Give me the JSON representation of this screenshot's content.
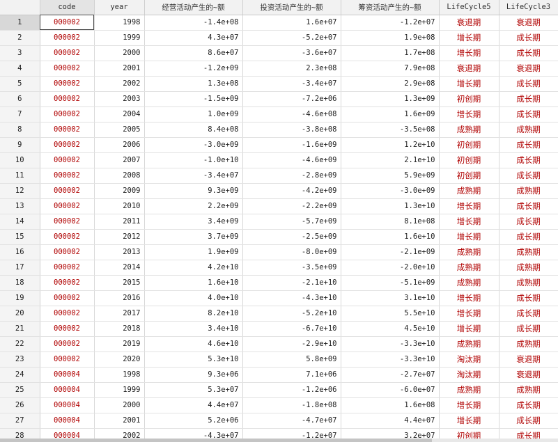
{
  "columns": [
    "code",
    "year",
    "经营活动产生的~额",
    "投资活动产生的~额",
    "筹资活动产生的~额",
    "LifeCycle5",
    "LifeCycle3"
  ],
  "selected_row": 1,
  "rows": [
    {
      "n": "1",
      "code": "000002",
      "year": "1998",
      "op": "-1.4e+08",
      "inv": "1.6e+07",
      "fin": "-1.2e+07",
      "lc5": "衰退期",
      "lc3": "衰退期"
    },
    {
      "n": "2",
      "code": "000002",
      "year": "1999",
      "op": "4.3e+07",
      "inv": "-5.2e+07",
      "fin": "1.9e+08",
      "lc5": "增长期",
      "lc3": "成长期"
    },
    {
      "n": "3",
      "code": "000002",
      "year": "2000",
      "op": "8.6e+07",
      "inv": "-3.6e+07",
      "fin": "1.7e+08",
      "lc5": "增长期",
      "lc3": "成长期"
    },
    {
      "n": "4",
      "code": "000002",
      "year": "2001",
      "op": "-1.2e+09",
      "inv": "2.3e+08",
      "fin": "7.9e+08",
      "lc5": "衰退期",
      "lc3": "衰退期"
    },
    {
      "n": "5",
      "code": "000002",
      "year": "2002",
      "op": "1.3e+08",
      "inv": "-3.4e+07",
      "fin": "2.9e+08",
      "lc5": "增长期",
      "lc3": "成长期"
    },
    {
      "n": "6",
      "code": "000002",
      "year": "2003",
      "op": "-1.5e+09",
      "inv": "-7.2e+06",
      "fin": "1.3e+09",
      "lc5": "初创期",
      "lc3": "成长期"
    },
    {
      "n": "7",
      "code": "000002",
      "year": "2004",
      "op": "1.0e+09",
      "inv": "-4.6e+08",
      "fin": "1.6e+09",
      "lc5": "增长期",
      "lc3": "成长期"
    },
    {
      "n": "8",
      "code": "000002",
      "year": "2005",
      "op": "8.4e+08",
      "inv": "-3.8e+08",
      "fin": "-3.5e+08",
      "lc5": "成熟期",
      "lc3": "成熟期"
    },
    {
      "n": "9",
      "code": "000002",
      "year": "2006",
      "op": "-3.0e+09",
      "inv": "-1.6e+09",
      "fin": "1.2e+10",
      "lc5": "初创期",
      "lc3": "成长期"
    },
    {
      "n": "10",
      "code": "000002",
      "year": "2007",
      "op": "-1.0e+10",
      "inv": "-4.6e+09",
      "fin": "2.1e+10",
      "lc5": "初创期",
      "lc3": "成长期"
    },
    {
      "n": "11",
      "code": "000002",
      "year": "2008",
      "op": "-3.4e+07",
      "inv": "-2.8e+09",
      "fin": "5.9e+09",
      "lc5": "初创期",
      "lc3": "成长期"
    },
    {
      "n": "12",
      "code": "000002",
      "year": "2009",
      "op": "9.3e+09",
      "inv": "-4.2e+09",
      "fin": "-3.0e+09",
      "lc5": "成熟期",
      "lc3": "成熟期"
    },
    {
      "n": "13",
      "code": "000002",
      "year": "2010",
      "op": "2.2e+09",
      "inv": "-2.2e+09",
      "fin": "1.3e+10",
      "lc5": "增长期",
      "lc3": "成长期"
    },
    {
      "n": "14",
      "code": "000002",
      "year": "2011",
      "op": "3.4e+09",
      "inv": "-5.7e+09",
      "fin": "8.1e+08",
      "lc5": "增长期",
      "lc3": "成长期"
    },
    {
      "n": "15",
      "code": "000002",
      "year": "2012",
      "op": "3.7e+09",
      "inv": "-2.5e+09",
      "fin": "1.6e+10",
      "lc5": "增长期",
      "lc3": "成长期"
    },
    {
      "n": "16",
      "code": "000002",
      "year": "2013",
      "op": "1.9e+09",
      "inv": "-8.0e+09",
      "fin": "-2.1e+09",
      "lc5": "成熟期",
      "lc3": "成熟期"
    },
    {
      "n": "17",
      "code": "000002",
      "year": "2014",
      "op": "4.2e+10",
      "inv": "-3.5e+09",
      "fin": "-2.0e+10",
      "lc5": "成熟期",
      "lc3": "成熟期"
    },
    {
      "n": "18",
      "code": "000002",
      "year": "2015",
      "op": "1.6e+10",
      "inv": "-2.1e+10",
      "fin": "-5.1e+09",
      "lc5": "成熟期",
      "lc3": "成熟期"
    },
    {
      "n": "19",
      "code": "000002",
      "year": "2016",
      "op": "4.0e+10",
      "inv": "-4.3e+10",
      "fin": "3.1e+10",
      "lc5": "增长期",
      "lc3": "成长期"
    },
    {
      "n": "20",
      "code": "000002",
      "year": "2017",
      "op": "8.2e+10",
      "inv": "-5.2e+10",
      "fin": "5.5e+10",
      "lc5": "增长期",
      "lc3": "成长期"
    },
    {
      "n": "21",
      "code": "000002",
      "year": "2018",
      "op": "3.4e+10",
      "inv": "-6.7e+10",
      "fin": "4.5e+10",
      "lc5": "增长期",
      "lc3": "成长期"
    },
    {
      "n": "22",
      "code": "000002",
      "year": "2019",
      "op": "4.6e+10",
      "inv": "-2.9e+10",
      "fin": "-3.3e+10",
      "lc5": "成熟期",
      "lc3": "成熟期"
    },
    {
      "n": "23",
      "code": "000002",
      "year": "2020",
      "op": "5.3e+10",
      "inv": "5.8e+09",
      "fin": "-3.3e+10",
      "lc5": "淘汰期",
      "lc3": "衰退期"
    },
    {
      "n": "24",
      "code": "000004",
      "year": "1998",
      "op": "9.3e+06",
      "inv": "7.1e+06",
      "fin": "-2.7e+07",
      "lc5": "淘汰期",
      "lc3": "衰退期"
    },
    {
      "n": "25",
      "code": "000004",
      "year": "1999",
      "op": "5.3e+07",
      "inv": "-1.2e+06",
      "fin": "-6.0e+07",
      "lc5": "成熟期",
      "lc3": "成熟期"
    },
    {
      "n": "26",
      "code": "000004",
      "year": "2000",
      "op": "4.4e+07",
      "inv": "-1.8e+08",
      "fin": "1.6e+08",
      "lc5": "增长期",
      "lc3": "成长期"
    },
    {
      "n": "27",
      "code": "000004",
      "year": "2001",
      "op": "5.2e+06",
      "inv": "-4.7e+07",
      "fin": "4.4e+07",
      "lc5": "增长期",
      "lc3": "成长期"
    },
    {
      "n": "28",
      "code": "000004",
      "year": "2002",
      "op": "-4.3e+07",
      "inv": "-1.2e+07",
      "fin": "3.2e+07",
      "lc5": "初创期",
      "lc3": "成长期"
    }
  ]
}
